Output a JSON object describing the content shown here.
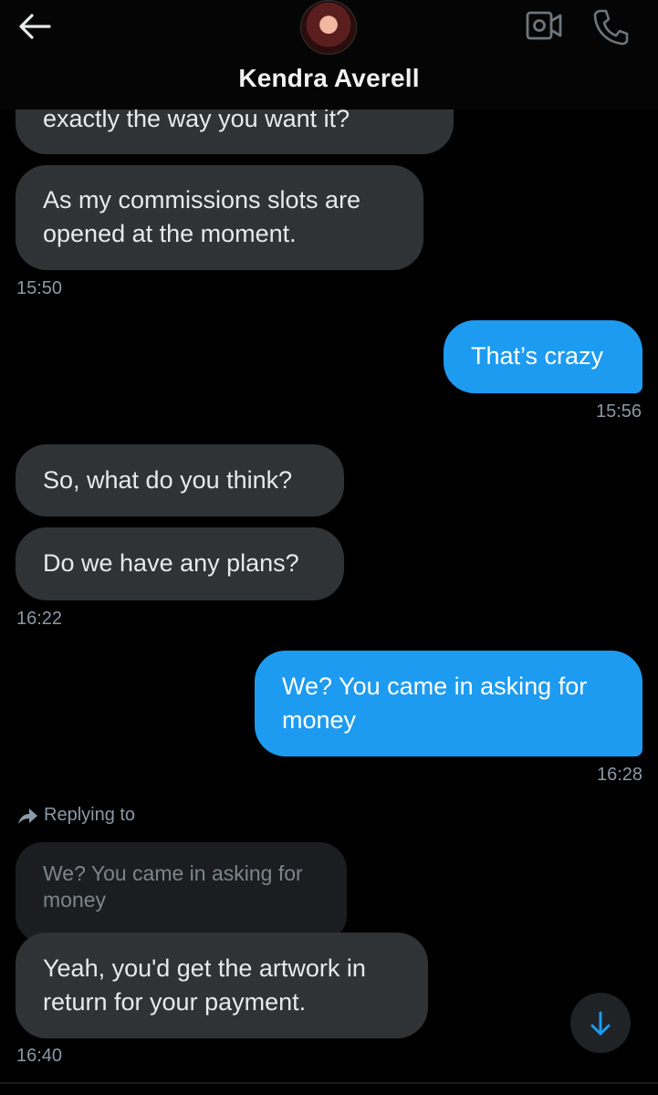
{
  "header": {
    "contact_name": "Kendra Averell"
  },
  "icons": {
    "back": "arrow-left-icon",
    "video": "video-camera-icon",
    "phone": "phone-icon",
    "reply": "reply-arrow-icon",
    "scroll": "arrow-down-icon"
  },
  "colors": {
    "incoming_bubble": "#2f3336",
    "outgoing_bubble": "#1d9bf0",
    "background": "#000000",
    "timestamp": "#8b98a5"
  },
  "messages": [
    {
      "direction": "in",
      "text": "exactly the way you want it?"
    },
    {
      "direction": "in",
      "text": "As my commissions slots are opened at the moment.",
      "time": "15:50"
    },
    {
      "direction": "out",
      "text": "That’s crazy",
      "time": "15:56"
    },
    {
      "direction": "in",
      "text": "So, what do you think?"
    },
    {
      "direction": "in",
      "text": "Do we have any plans?",
      "time": "16:22"
    },
    {
      "direction": "out",
      "text": "We? You came in asking for money",
      "time": "16:28"
    },
    {
      "direction": "in",
      "text": "Yeah, you'd get the artwork in return for your payment.",
      "time": "16:40",
      "reply": {
        "label": "Replying to",
        "quoted_text": "We? You came in asking for money"
      }
    }
  ]
}
